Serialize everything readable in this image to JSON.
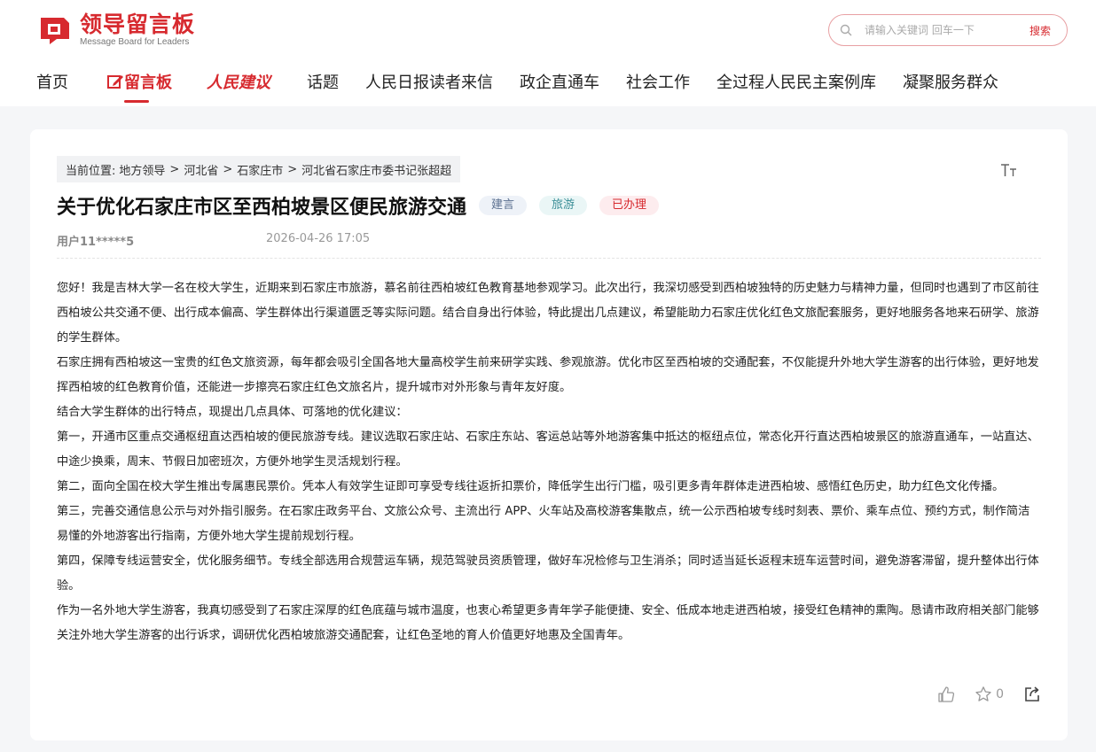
{
  "header": {
    "logo_title": "领导留言板",
    "logo_subtitle": "Message Board for Leaders",
    "search_placeholder": "请输入关键词 回车一下",
    "search_button": "搜索"
  },
  "nav": {
    "items": [
      "首页",
      "留言板",
      "人民建议",
      "话题",
      "人民日报读者来信",
      "政企直通车",
      "社会工作",
      "全过程人民民主案例库",
      "凝聚服务群众"
    ]
  },
  "breadcrumb": {
    "prefix": "当前位置:",
    "items": [
      "地方领导",
      ">",
      "河北省",
      ">",
      "石家庄市",
      ">",
      "河北省石家庄市委书记张超超"
    ]
  },
  "message": {
    "title": "关于优化石家庄市区至西柏坡景区便民旅游交通",
    "tags": [
      "建言",
      "旅游",
      "已办理"
    ],
    "user": "用户11*****5",
    "datetime": "2026-04-26 17:05",
    "paragraphs": [
      "您好！我是吉林大学一名在校大学生，近期来到石家庄市旅游，慕名前往西柏坡红色教育基地参观学习。此次出行，我深切感受到西柏坡独特的历史魅力与精神力量，但同时也遇到了市区前往西柏坡公共交通不便、出行成本偏高、学生群体出行渠道匮乏等实际问题。结合自身出行体验，特此提出几点建议，希望能助力石家庄优化红色文旅配套服务，更好地服务各地来石研学、旅游的学生群体。",
      "石家庄拥有西柏坡这一宝贵的红色文旅资源，每年都会吸引全国各地大量高校学生前来研学实践、参观旅游。优化市区至西柏坡的交通配套，不仅能提升外地大学生游客的出行体验，更好地发挥西柏坡的红色教育价值，还能进一步擦亮石家庄红色文旅名片，提升城市对外形象与青年友好度。",
      "结合大学生群体的出行特点，现提出几点具体、可落地的优化建议：",
      "第一，开通市区重点交通枢纽直达西柏坡的便民旅游专线。建议选取石家庄站、石家庄东站、客运总站等外地游客集中抵达的枢纽点位，常态化开行直达西柏坡景区的旅游直通车，一站直达、中途少换乘，周末、节假日加密班次，方便外地学生灵活规划行程。",
      "第二，面向全国在校大学生推出专属惠民票价。凭本人有效学生证即可享受专线往返折扣票价，降低学生出行门槛，吸引更多青年群体走进西柏坡、感悟红色历史，助力红色文化传播。",
      "第三，完善交通信息公示与对外指引服务。在石家庄政务平台、文旅公众号、主流出行 APP、火车站及高校游客集散点，统一公示西柏坡专线时刻表、票价、乘车点位、预约方式，制作简洁易懂的外地游客出行指南，方便外地大学生提前规划行程。",
      "第四，保障专线运营安全，优化服务细节。专线全部选用合规营运车辆，规范驾驶员资质管理，做好车况检修与卫生消杀；同时适当延长返程末班车运营时间，避免游客滞留，提升整体出行体验。",
      "作为一名外地大学生游客，我真切感受到了石家庄深厚的红色底蕴与城市温度，也衷心希望更多青年学子能便捷、安全、低成本地走进西柏坡，接受红色精神的熏陶。恳请市政府相关部门能够关注外地大学生游客的出行诉求，调研优化西柏坡旅游交通配套，让红色圣地的育人价值更好地惠及全国青年。"
    ]
  },
  "actions": {
    "favorite_count": "0"
  },
  "colors": {
    "brand_red": "#d72a2f",
    "page_bg": "#f5f6f8"
  }
}
